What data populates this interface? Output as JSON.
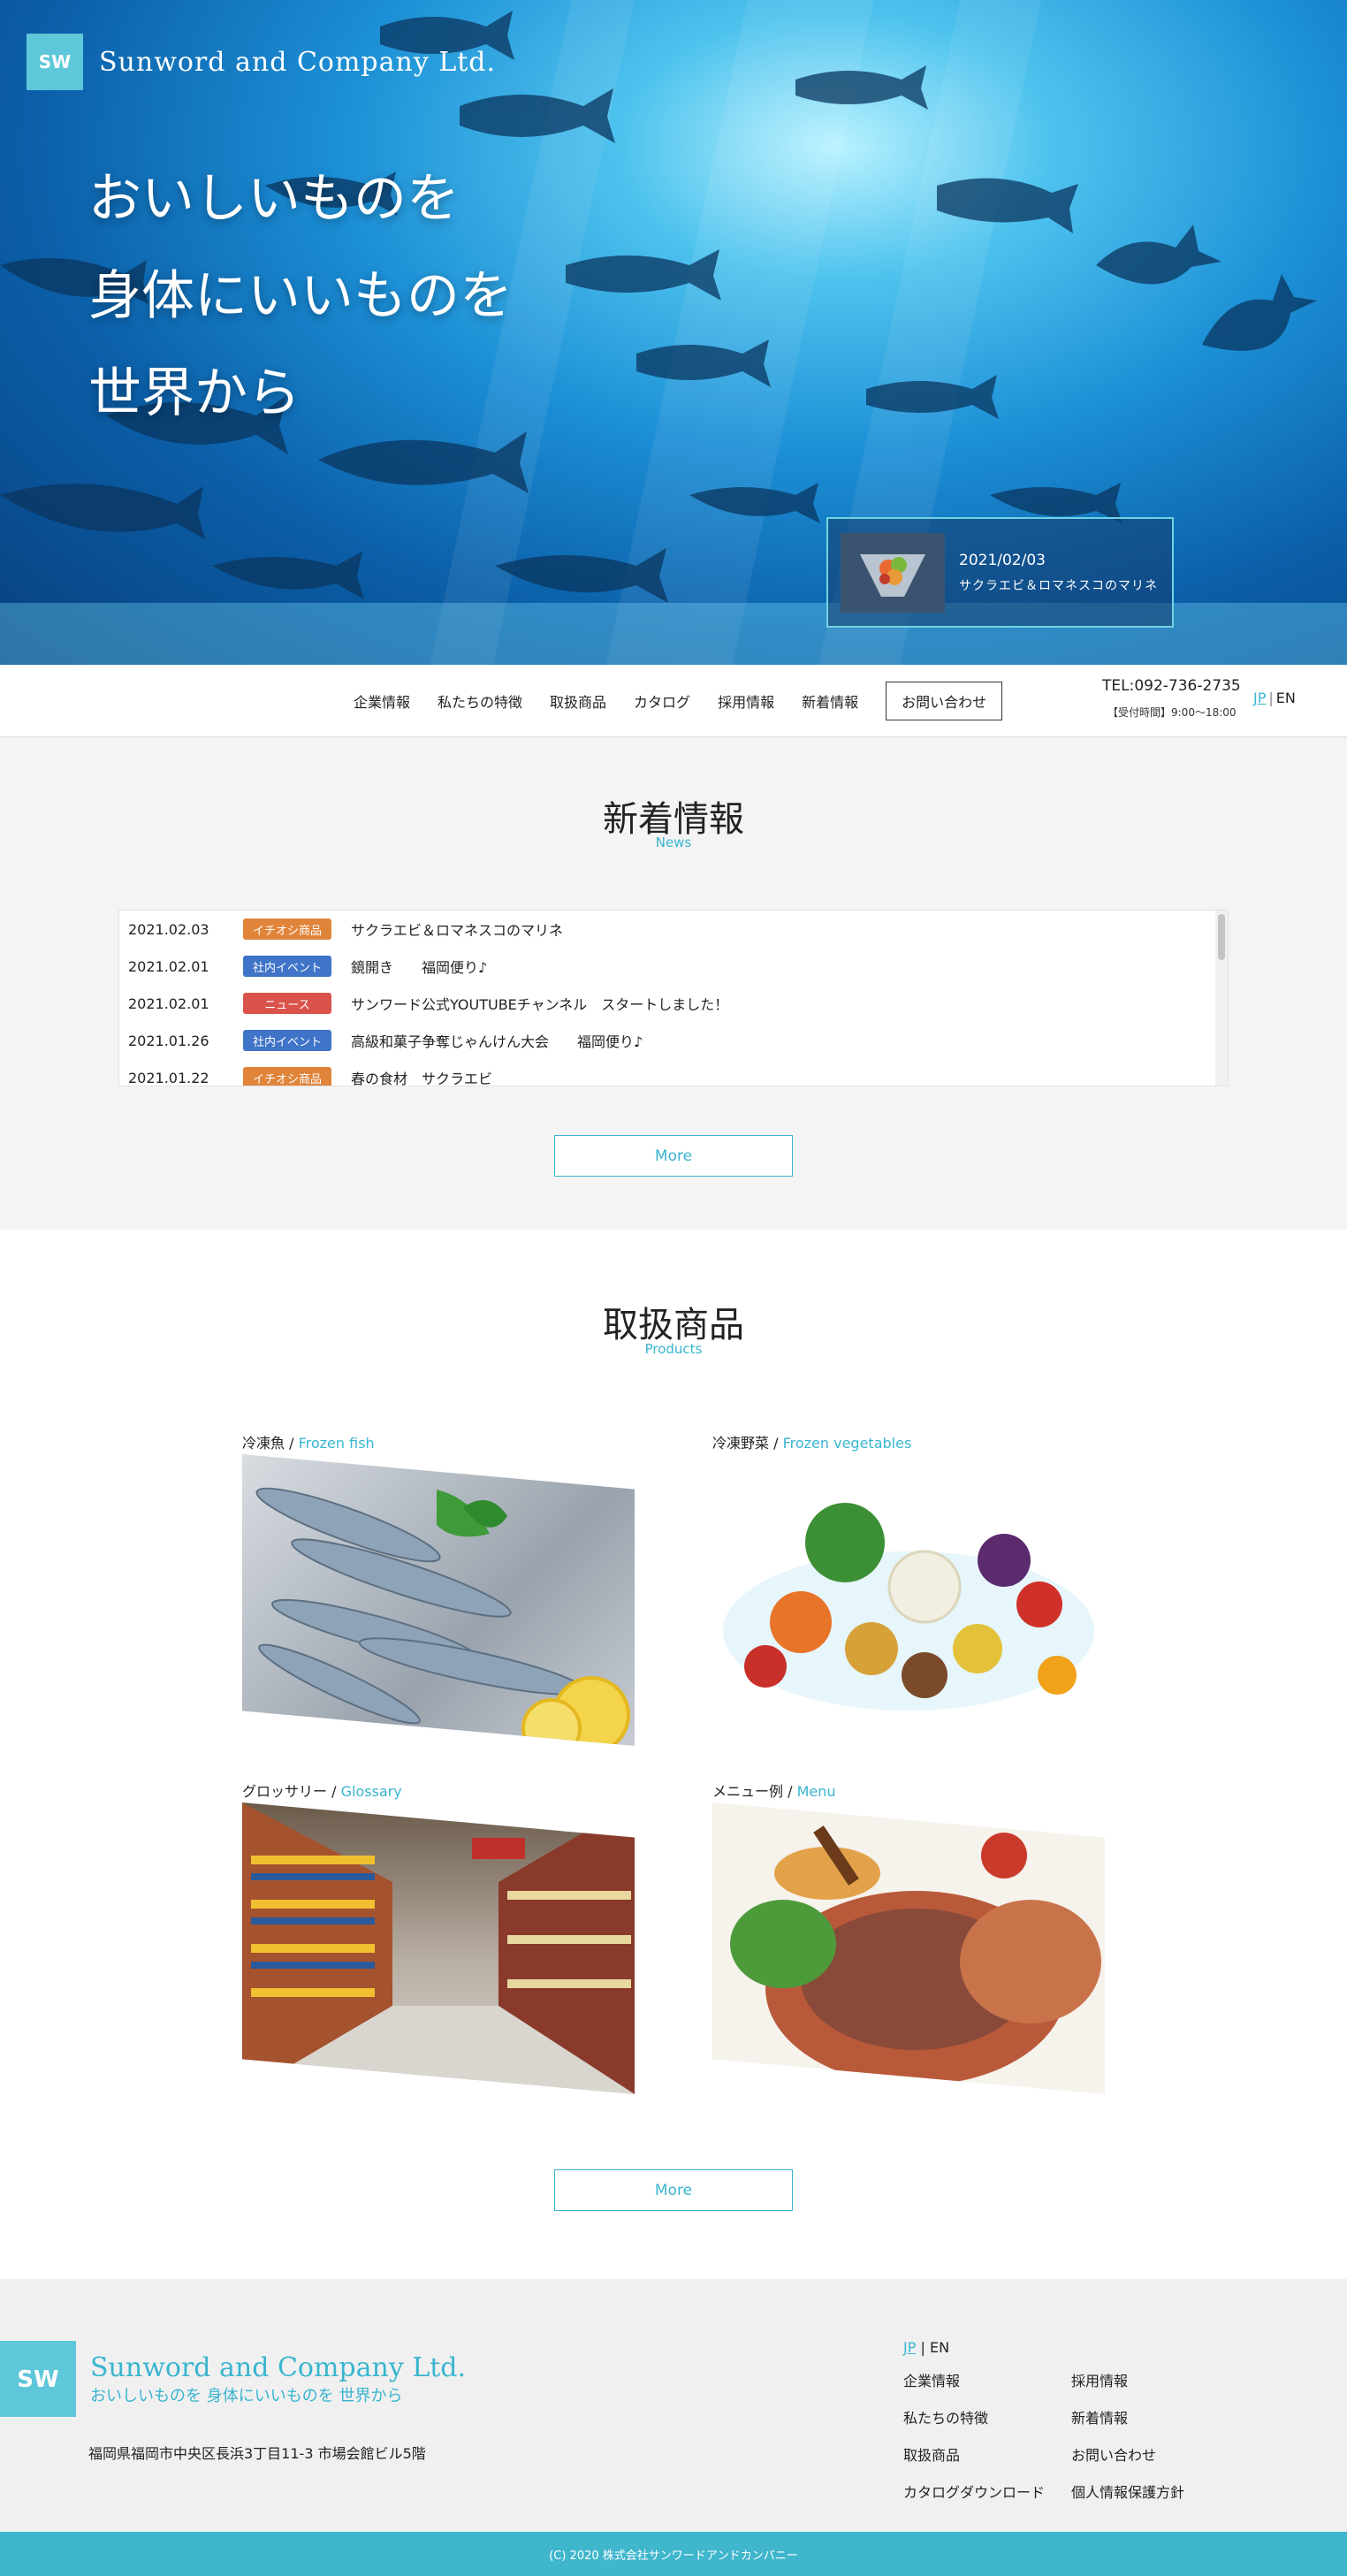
{
  "brand": {
    "name": "Sunword and Company Ltd.",
    "logo_letters": "SW",
    "accent": "#39b5cf"
  },
  "hero": {
    "catch_lines": [
      "おいしいものを",
      "身体にいいものを",
      "世界から"
    ],
    "news_card": {
      "date": "2021/02/03",
      "title": "サクラエビ＆ロマネスコのマリネ"
    }
  },
  "nav": {
    "items": [
      "企業情報",
      "私たちの特徴",
      "取扱商品",
      "カタログ",
      "採用情報",
      "新着情報"
    ],
    "contact": "お問い合わせ",
    "tel": "TEL:092-736-2735",
    "hours": "【受付時間】9:00〜18:00",
    "lang_jp": "JP",
    "lang_sep": "|",
    "lang_en": "EN"
  },
  "news": {
    "title": "新着情報",
    "subtitle": "News",
    "rows": [
      {
        "date": "2021.02.03",
        "badge": "イチオシ商品",
        "badge_color": "#e0843a",
        "text": "サクラエビ＆ロマネスコのマリネ"
      },
      {
        "date": "2021.02.01",
        "badge": "社内イベント",
        "badge_color": "#3f74c8",
        "text": "鏡開き　　福岡便り♪"
      },
      {
        "date": "2021.02.01",
        "badge": "ニュース",
        "badge_color": "#d9534a",
        "text": "サンワード公式YOUTUBEチャンネル　スタートしました！"
      },
      {
        "date": "2021.01.26",
        "badge": "社内イベント",
        "badge_color": "#3f74c8",
        "text": "高級和菓子争奪じゃんけん大会　　福岡便り♪"
      },
      {
        "date": "2021.01.22",
        "badge": "イチオシ商品",
        "badge_color": "#e0843a",
        "text": "春の食材　サクラエビ"
      }
    ],
    "more": "More"
  },
  "products": {
    "title": "取扱商品",
    "subtitle": "Products",
    "items": [
      {
        "ja": "冷凍魚",
        "en": "Frozen fish"
      },
      {
        "ja": "冷凍野菜",
        "en": "Frozen vegetables"
      },
      {
        "ja": "グロッサリー",
        "en": "Glossary"
      },
      {
        "ja": "メニュー例",
        "en": "Menu"
      }
    ],
    "slash": "/",
    "more": "More"
  },
  "footer": {
    "company": "Sunword and Company Ltd.",
    "catch": "おいしいものを 身体にいいものを 世界から",
    "address": "福岡県福岡市中央区長浜3丁目11-3 市場会館ビル5階",
    "lang_jp": "JP",
    "lang_sep": "|",
    "lang_en": "EN",
    "links": [
      "企業情報",
      "採用情報",
      "私たちの特徴",
      "新着情報",
      "取扱商品",
      "お問い合わせ",
      "カタログダウンロード",
      "個人情報保護方針"
    ],
    "copyright": "(C) 2020 株式会社サンワードアンドカンパニー"
  }
}
